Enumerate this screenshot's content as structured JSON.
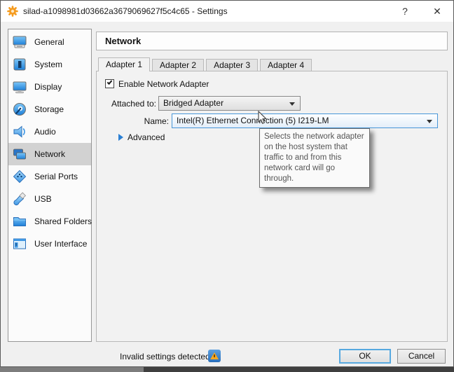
{
  "window": {
    "title": "silad-a1098981d03662a3679069627f5c4c65 - Settings",
    "help_label": "?",
    "close_label": "✕"
  },
  "sidebar": {
    "items": [
      {
        "label": "General",
        "icon": "general-icon",
        "selected": false
      },
      {
        "label": "System",
        "icon": "system-icon",
        "selected": false
      },
      {
        "label": "Display",
        "icon": "display-icon",
        "selected": false
      },
      {
        "label": "Storage",
        "icon": "storage-icon",
        "selected": false
      },
      {
        "label": "Audio",
        "icon": "audio-icon",
        "selected": false
      },
      {
        "label": "Network",
        "icon": "network-icon",
        "selected": true
      },
      {
        "label": "Serial Ports",
        "icon": "serial-ports-icon",
        "selected": false
      },
      {
        "label": "USB",
        "icon": "usb-icon",
        "selected": false
      },
      {
        "label": "Shared Folders",
        "icon": "shared-folders-icon",
        "selected": false
      },
      {
        "label": "User Interface",
        "icon": "user-interface-icon",
        "selected": false
      }
    ]
  },
  "main": {
    "heading": "Network",
    "tabs": [
      {
        "label": "Adapter 1",
        "selected": true
      },
      {
        "label": "Adapter 2",
        "selected": false
      },
      {
        "label": "Adapter 3",
        "selected": false
      },
      {
        "label": "Adapter 4",
        "selected": false
      }
    ],
    "form": {
      "enable_label": "Enable Network Adapter",
      "enable_checked": true,
      "attached_to_label": "Attached to:",
      "attached_to_value": "Bridged Adapter",
      "name_label": "Name:",
      "name_value": "Intel(R) Ethernet Connection (5) I219-LM",
      "advanced_label": "Advanced"
    },
    "tooltip": {
      "text": "Selects the network adapter on the host system that traffic to and from this network card will go through."
    }
  },
  "footer": {
    "status_text": "Invalid settings detected",
    "ok_label": "OK",
    "cancel_label": "Cancel"
  },
  "colors": {
    "selection_gray": "#d2d2d2",
    "focus_blue": "#57a9e0",
    "combo_focus_border": "#4796d8",
    "icon_blue": "#2e8fe0",
    "warning_orange": "#f6a821",
    "warning_badge_blue": "#2a6fba",
    "titlebar_bg": "#ffffff",
    "window_bg": "#f0f0f0"
  }
}
